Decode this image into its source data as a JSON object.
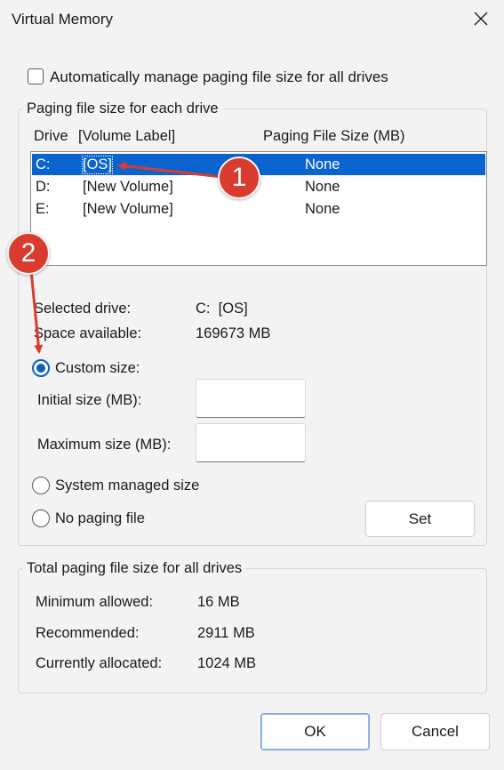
{
  "window": {
    "title": "Virtual Memory"
  },
  "auto_manage": {
    "label": "Automatically manage paging file size for all drives",
    "checked": false
  },
  "per_drive": {
    "group_label": "Paging file size for each drive",
    "columns": {
      "drive": "Drive",
      "volume": "[Volume Label]",
      "size": "Paging File Size (MB)"
    },
    "rows": [
      {
        "drive": "C:",
        "volume": "[OS]",
        "size": "None",
        "selected": true
      },
      {
        "drive": "D:",
        "volume": "[New Volume]",
        "size": "None",
        "selected": false
      },
      {
        "drive": "E:",
        "volume": "[New Volume]",
        "size": "None",
        "selected": false
      }
    ],
    "selected_drive_label": "Selected drive:",
    "selected_drive_value": "C:  [OS]",
    "space_available_label": "Space available:",
    "space_available_value": "169673 MB",
    "custom_size_label": "Custom size:",
    "initial_size_label": "Initial size (MB):",
    "initial_size_value": "",
    "maximum_size_label": "Maximum size (MB):",
    "maximum_size_value": "",
    "system_managed_label": "System managed size",
    "no_paging_label": "No paging file",
    "selected_option": "custom",
    "set_button": "Set"
  },
  "totals": {
    "group_label": "Total paging file size for all drives",
    "minimum_label": "Minimum allowed:",
    "minimum_value": "16 MB",
    "recommended_label": "Recommended:",
    "recommended_value": "2911 MB",
    "allocated_label": "Currently allocated:",
    "allocated_value": "1024 MB"
  },
  "buttons": {
    "ok": "OK",
    "cancel": "Cancel"
  },
  "annotations": {
    "marker1": "1",
    "marker2": "2"
  },
  "colors": {
    "selection": "#0a64cf",
    "accent": "#0a5ec4",
    "annotation": "#d93b2e"
  },
  "icons": {
    "close": "close-icon"
  }
}
